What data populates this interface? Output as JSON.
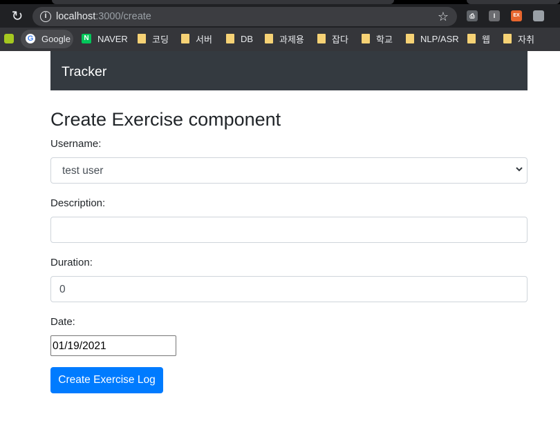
{
  "browser": {
    "url_host": "localhost",
    "url_path": ":3000/create",
    "bookmarks": [
      {
        "label": "Google",
        "icon": "google-icon"
      },
      {
        "label": "NAVER",
        "icon": "naver-icon"
      },
      {
        "label": "코딩",
        "icon": "folder-icon"
      },
      {
        "label": "서버",
        "icon": "folder-icon"
      },
      {
        "label": "DB",
        "icon": "folder-icon"
      },
      {
        "label": "과제용",
        "icon": "folder-icon"
      },
      {
        "label": "잡다",
        "icon": "folder-icon"
      },
      {
        "label": "학교",
        "icon": "folder-icon"
      },
      {
        "label": "NLP/ASR",
        "icon": "folder-icon"
      },
      {
        "label": "웹",
        "icon": "folder-icon"
      },
      {
        "label": "자취",
        "icon": "folder-icon"
      }
    ],
    "extensions": [
      "printer-icon",
      "I",
      "EX",
      "puzzle-icon"
    ],
    "colors": {
      "chrome_bg": "#202124",
      "toolbar_bg": "#35363a",
      "omnibox_bg": "#3c3d41"
    }
  },
  "navbar": {
    "brand": "Tracker",
    "bg": "#343a40"
  },
  "page": {
    "title": "Create Exercise component",
    "username_label": "Username:",
    "username_selected": "test user",
    "description_label": "Description:",
    "description_value": "",
    "duration_label": "Duration:",
    "duration_value": "0",
    "date_label": "Date:",
    "date_value": "01/19/2021",
    "submit_label": "Create Exercise Log",
    "accent": "#007bff"
  }
}
